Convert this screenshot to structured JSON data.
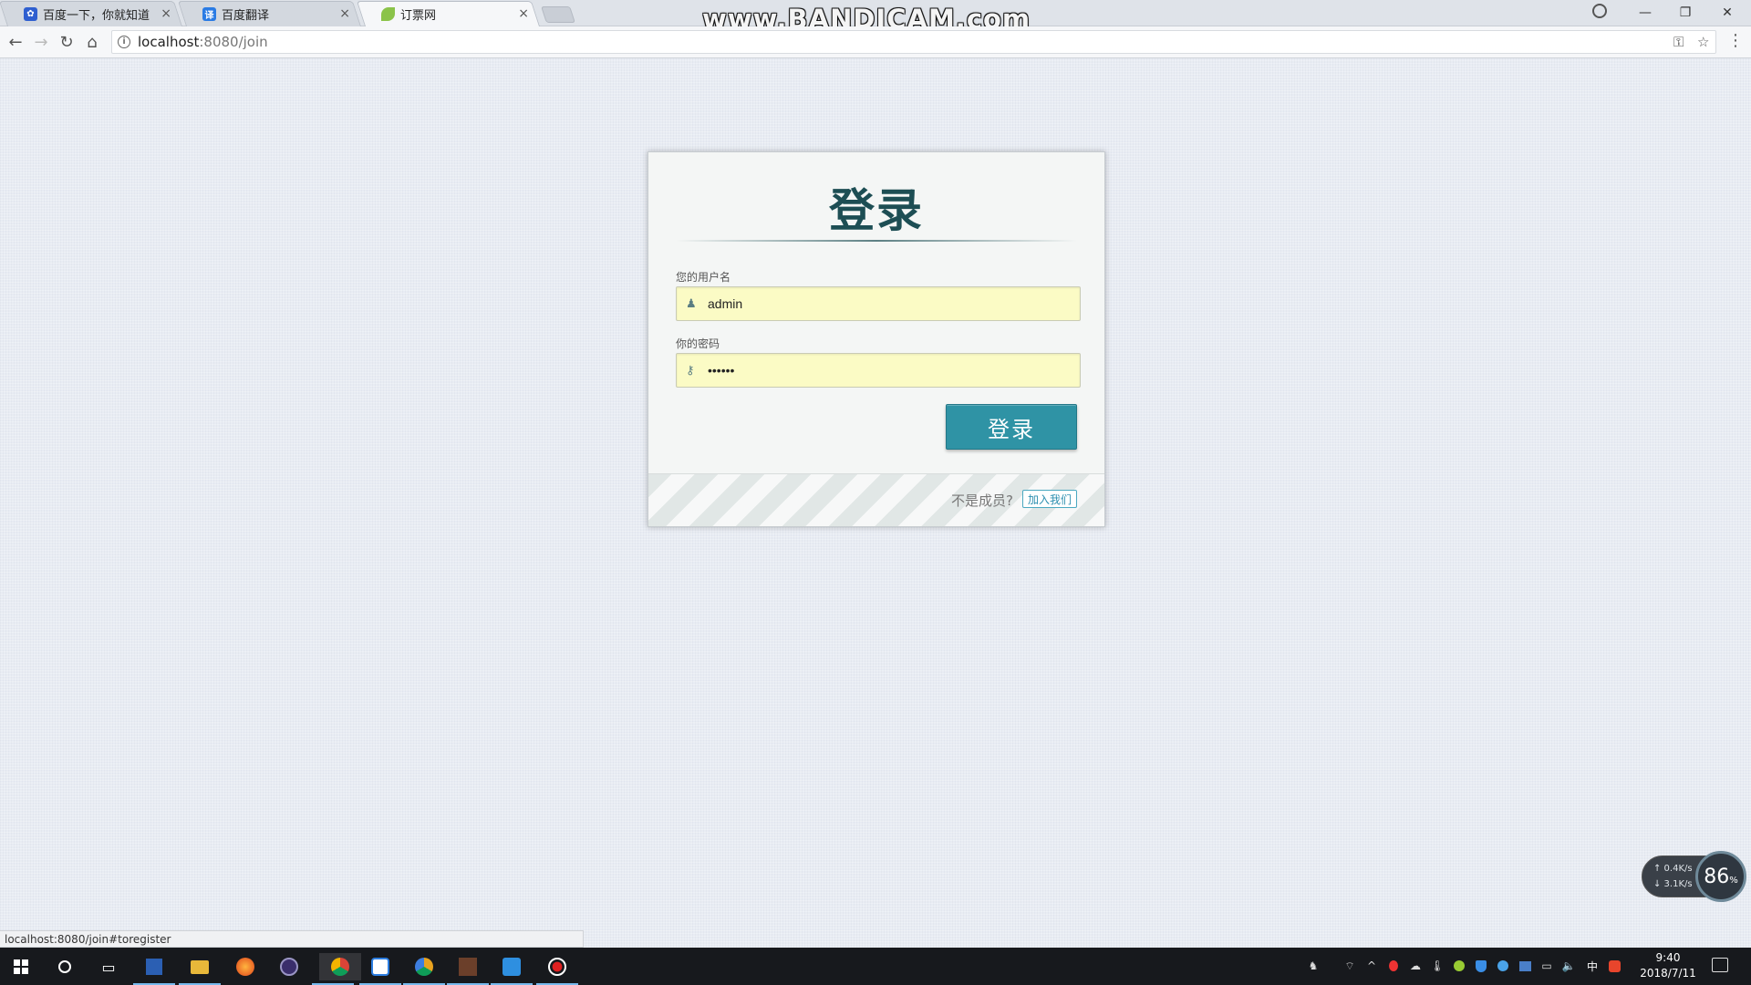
{
  "browser": {
    "tabs": [
      {
        "label": "百度一下，你就知道",
        "favicon": "baidu-paw-icon",
        "color": "#2f5fd0",
        "active": false
      },
      {
        "label": "百度翻译",
        "favicon": "baidu-translate-icon",
        "color": "#2a7be4",
        "active": false
      },
      {
        "label": "订票网",
        "favicon": "leaf-icon",
        "color": "#8bc34a",
        "active": true
      }
    ],
    "tab_close_glyph": "×",
    "watermark": "www.BANDICAM.com",
    "window_controls": {
      "minimize": "—",
      "restore": "❐",
      "close": "✕"
    },
    "url": {
      "host": "localhost",
      "path": ":8080/join"
    },
    "nav": {
      "back": "←",
      "forward": "→",
      "reload": "↻",
      "home": "⌂"
    },
    "omni_icons": {
      "key": "⚿",
      "star": "☆"
    },
    "menu": "⋮",
    "status_url": "localhost:8080/join#toregister"
  },
  "login": {
    "title": "登录",
    "username_label": "您的用户名",
    "username_value": "admin",
    "password_label": "你的密码",
    "password_value": "••••••",
    "submit_label": "登录",
    "footer_text": "不是成员?",
    "join_label": "加入我们",
    "accent_color": "#2f93a5",
    "field_bg": "#fbfbc5"
  },
  "net_widget": {
    "up": "↑ 0.4K/s",
    "down": "↓ 3.1K/s",
    "percent": "86",
    "percent_unit": "%"
  },
  "taskbar": {
    "pinned": [
      "windows-start-icon",
      "cortana-icon",
      "task-view-icon",
      "contacts-app-icon",
      "file-explorer-icon",
      "firefox-icon",
      "eclipse-icon",
      "chrome-icon",
      "baidu-netdisk-icon",
      "chrome-canary-icon",
      "game-icon",
      "ws-office-icon",
      "record-icon"
    ],
    "ime": "中",
    "time": "9:40",
    "date": "2018/7/11"
  }
}
